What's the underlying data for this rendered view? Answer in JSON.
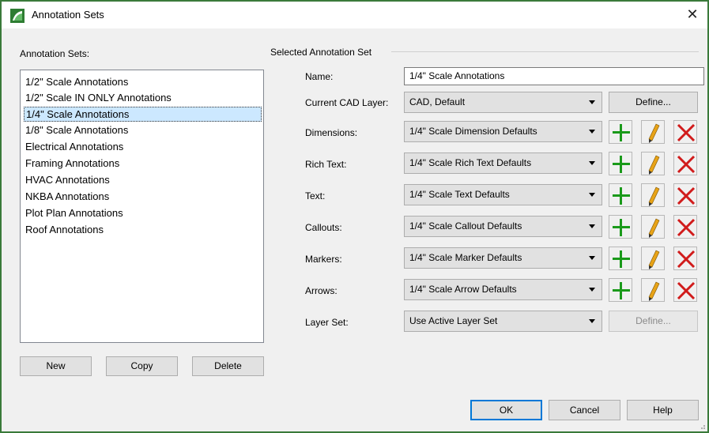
{
  "window": {
    "title": "Annotation Sets",
    "close_glyph": "✕",
    "icon": "app-logo-icon",
    "accent": "#3a7a3a"
  },
  "left": {
    "label": "Annotation Sets:",
    "items": [
      "1/2\" Scale Annotations",
      "1/2\" Scale IN ONLY Annotations",
      "1/4\" Scale Annotations",
      "1/8\" Scale Annotations",
      "Electrical Annotations",
      "Framing Annotations",
      "HVAC Annotations",
      "NKBA Annotations",
      "Plot Plan Annotations",
      "Roof Annotations"
    ],
    "selected_index": 2,
    "buttons": {
      "new": "New",
      "copy": "Copy",
      "delete": "Delete"
    }
  },
  "right": {
    "group_label": "Selected Annotation Set",
    "name_label": "Name:",
    "name_value": "1/4\" Scale Annotations",
    "cad_layer_label": "Current CAD Layer:",
    "cad_layer_value": "CAD,  Default",
    "define_label": "Define...",
    "rows": [
      {
        "label": "Dimensions:",
        "value": "1/4\" Scale Dimension Defaults"
      },
      {
        "label": "Rich Text:",
        "value": "1/4\" Scale Rich Text Defaults"
      },
      {
        "label": "Text:",
        "value": "1/4\" Scale Text Defaults"
      },
      {
        "label": "Callouts:",
        "value": "1/4\" Scale Callout Defaults"
      },
      {
        "label": "Markers:",
        "value": "1/4\" Scale Marker Defaults"
      },
      {
        "label": "Arrows:",
        "value": "1/4\" Scale Arrow Defaults"
      }
    ],
    "layer_set_label": "Layer Set:",
    "layer_set_value": "Use Active Layer Set",
    "layer_define_label": "Define...",
    "icons": {
      "add": "plus-icon",
      "edit": "pencil-icon",
      "delete": "red-x-icon"
    },
    "colors": {
      "add": "#1a9a1a",
      "delete": "#d11b1b",
      "pencil": "#e8a317"
    }
  },
  "footer": {
    "ok": "OK",
    "cancel": "Cancel",
    "help": "Help"
  }
}
